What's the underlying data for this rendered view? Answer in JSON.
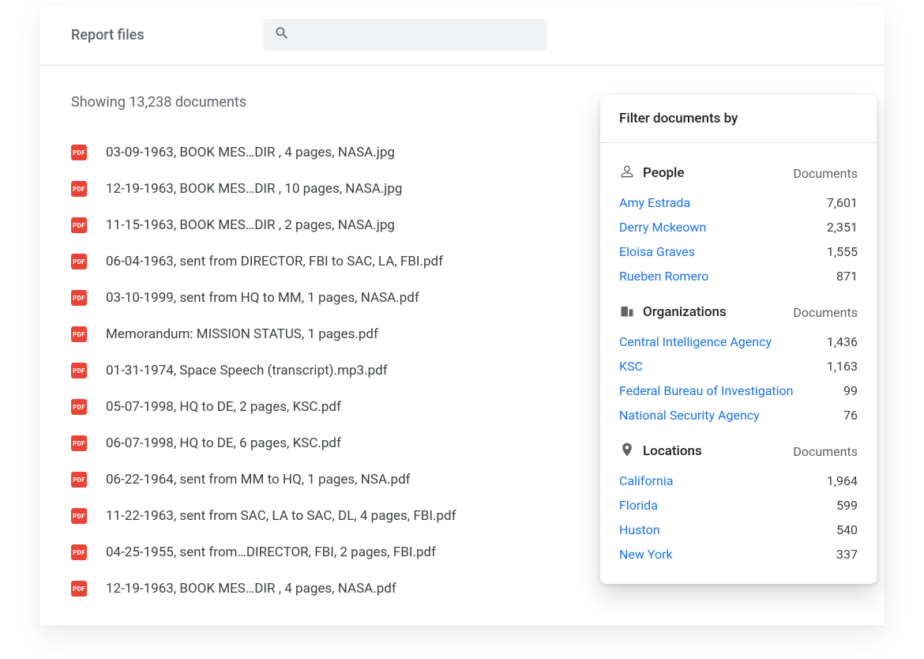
{
  "header": {
    "title": "Report files",
    "search_placeholder": ""
  },
  "results": {
    "count_label": "Showing 13,238 documents",
    "files": [
      {
        "badge": "PDF",
        "name": "03-09-1963, BOOK MES…DIR , 4 pages, NASA.jpg"
      },
      {
        "badge": "PDF",
        "name": "12-19-1963, BOOK MES…DIR , 10 pages, NASA.jpg"
      },
      {
        "badge": "PDF",
        "name": "11-15-1963, BOOK MES…DIR , 2 pages, NASA.jpg"
      },
      {
        "badge": "PDF",
        "name": "06-04-1963, sent from DIRECTOR, FBI to SAC, LA, FBI.pdf"
      },
      {
        "badge": "PDF",
        "name": "03-10-1999, sent from HQ to MM, 1 pages, NASA.pdf"
      },
      {
        "badge": "PDF",
        "name": "Memorandum: MISSION STATUS, 1 pages.pdf"
      },
      {
        "badge": "PDF",
        "name": "01-31-1974, Space Speech (transcript).mp3.pdf"
      },
      {
        "badge": "PDF",
        "name": "05-07-1998, HQ to DE, 2 pages, KSC.pdf"
      },
      {
        "badge": "PDF",
        "name": "06-07-1998, HQ to DE, 6 pages, KSC.pdf"
      },
      {
        "badge": "PDF",
        "name": "06-22-1964, sent from MM to HQ, 1 pages, NSA.pdf"
      },
      {
        "badge": "PDF",
        "name": "11-22-1963, sent from SAC, LA to SAC, DL, 4 pages, FBI.pdf"
      },
      {
        "badge": "PDF",
        "name": "04-25-1955, sent from…DIRECTOR, FBI, 2 pages, FBI.pdf"
      },
      {
        "badge": "PDF",
        "name": "12-19-1963, BOOK MES…DIR , 4 pages, NASA.pdf"
      }
    ]
  },
  "filters": {
    "title": "Filter documents by",
    "documents_label": "Documents",
    "sections": [
      {
        "icon": "person",
        "title": "People",
        "items": [
          {
            "label": "Amy Estrada",
            "count": "7,601"
          },
          {
            "label": "Derry Mckeown",
            "count": "2,351"
          },
          {
            "label": "Eloisa Graves",
            "count": "1,555"
          },
          {
            "label": "Rueben Romero",
            "count": "871"
          }
        ]
      },
      {
        "icon": "org",
        "title": "Organizations",
        "items": [
          {
            "label": "Central Intelligence Agency",
            "count": "1,436"
          },
          {
            "label": "KSC",
            "count": "1,163"
          },
          {
            "label": "Federal Bureau of Investigation",
            "count": "99"
          },
          {
            "label": "National Security Agency",
            "count": "76"
          }
        ]
      },
      {
        "icon": "location",
        "title": "Locations",
        "items": [
          {
            "label": "California",
            "count": "1,964"
          },
          {
            "label": "Florida",
            "count": "599"
          },
          {
            "label": "Huston",
            "count": "540"
          },
          {
            "label": "New York",
            "count": "337"
          }
        ]
      }
    ]
  }
}
